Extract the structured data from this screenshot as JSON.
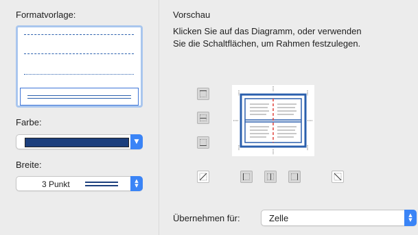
{
  "left": {
    "style_label": "Formatvorlage:",
    "color_label": "Farbe:",
    "color_value": "#1c3f7d",
    "width_label": "Breite:",
    "width_value": "3 Punkt"
  },
  "right": {
    "preview_title": "Vorschau",
    "instructions_line1": "Klicken Sie auf das Diagramm, oder verwenden",
    "instructions_line2": "Sie die Schaltflächen, um Rahmen festzulegen.",
    "apply_label": "Übernehmen für:",
    "apply_value": "Zelle"
  },
  "colors": {
    "border_blue": "#2a5fad",
    "accent": "#3a84f6",
    "inner_divider_red": "#e0403a"
  }
}
